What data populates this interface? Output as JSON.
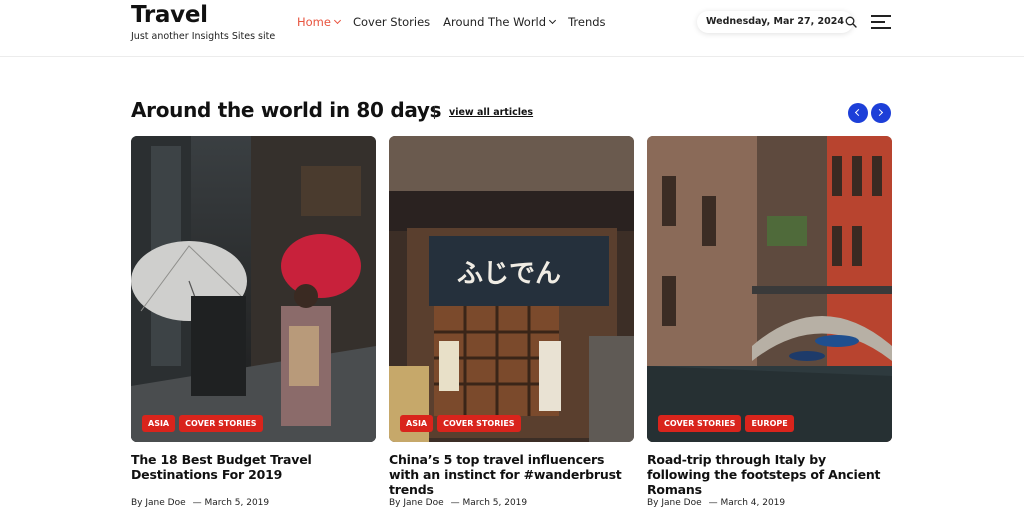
{
  "header": {
    "logo": "Travel",
    "tagline": "Just another Insights Sites site",
    "nav": [
      {
        "label": "Home",
        "active": true,
        "dropdown": true
      },
      {
        "label": "Cover Stories",
        "active": false,
        "dropdown": false
      },
      {
        "label": "Around The World",
        "active": false,
        "dropdown": true
      },
      {
        "label": "Trends",
        "active": false,
        "dropdown": false
      }
    ],
    "date": "Wednesday, Mar 27, 2024",
    "icons": [
      "search-icon",
      "hamburger-menu-icon"
    ]
  },
  "section": {
    "title": "Around the world in 80 days",
    "view_all": "view all articles",
    "icons": [
      "arrow-left-icon",
      "arrow-right-icon"
    ],
    "accent_color": "#1d3fd8"
  },
  "cards": [
    {
      "tags": [
        "ASIA",
        "COVER STORIES"
      ],
      "title": "The 18 Best Budget Travel Destinations For 2019",
      "author": "By Jane Doe",
      "date": "— March 5, 2019"
    },
    {
      "tags": [
        "ASIA",
        "COVER STORIES"
      ],
      "title": "China’s 5 top travel influencers with an instinct for #wanderbrust trends",
      "author": "By Jane Doe",
      "date": "— March 5, 2019"
    },
    {
      "tags": [
        "COVER STORIES",
        "EUROPE"
      ],
      "title": "Road-trip through Italy by following the footsteps of Ancient Romans",
      "author": "By Jane Doe",
      "date": "— March 4, 2019"
    }
  ],
  "colors": {
    "nav_active": "#e8543f",
    "tag_bg": "#d9241c"
  }
}
